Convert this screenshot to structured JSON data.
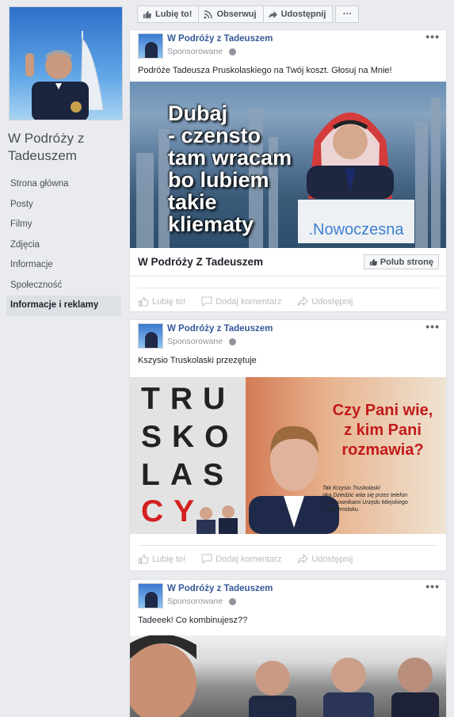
{
  "sidebar": {
    "page_name": "W Podróży z Tadeuszem",
    "nav": [
      {
        "label": "Strona główna"
      },
      {
        "label": "Posty"
      },
      {
        "label": "Filmy"
      },
      {
        "label": "Zdjęcia"
      },
      {
        "label": "Informacje"
      },
      {
        "label": "Społeczność"
      },
      {
        "label": "Informacje i reklamy"
      }
    ]
  },
  "actionbar": {
    "like": "Lubię to!",
    "follow": "Obserwuj",
    "share": "Udostępnij",
    "more": "···"
  },
  "posts": [
    {
      "author": "W Podróży z Tadeuszem",
      "sponsored": "Sponsorowane",
      "text": "Podróże Tadeusza Pruskolaskiego na Twój koszt. Głosuj na Mnie!",
      "image_text": {
        "headline": [
          "Dubaj",
          "- czensto",
          "tam wracam",
          "bo lubiem",
          "takie",
          "kliematy"
        ],
        "brand": ".Nowoczesna"
      },
      "link_title": "W Podróży Z Tadeuszem",
      "like_page": "Polub stronę",
      "actions": {
        "like": "Lubię to!",
        "comment": "Dodaj komentarz",
        "share": "Udostępnij"
      }
    },
    {
      "author": "W Podróży z Tadeuszem",
      "sponsored": "Sponsorowane",
      "text": "Kszysio Truskolaski przezętuje",
      "image_text": {
        "letters": [
          "TRU",
          "SKO",
          "LAS",
          "CY"
        ],
        "question": [
          "Czy Pani wie,",
          "z kim Pani",
          "rozmawia?"
        ],
        "small": [
          "Tak Krzysio Truskolaski",
          "aka Dziedzic wita się przez telefon",
          "z pracownikami Urzędu Miejskiego",
          "w Białymstoku."
        ]
      },
      "actions": {
        "like": "Lubię to!",
        "comment": "Dodaj komentarz",
        "share": "Udostępnij"
      }
    },
    {
      "author": "W Podróży z Tadeuszem",
      "sponsored": "Sponsorowane",
      "text": "Tadeeek! Co kombinujesz??"
    }
  ],
  "colors": {
    "link": "#365899",
    "bg": "#e9ebee",
    "accent_red": "#c21a1a",
    "nowoczesna_blue": "#3f7fd1"
  }
}
